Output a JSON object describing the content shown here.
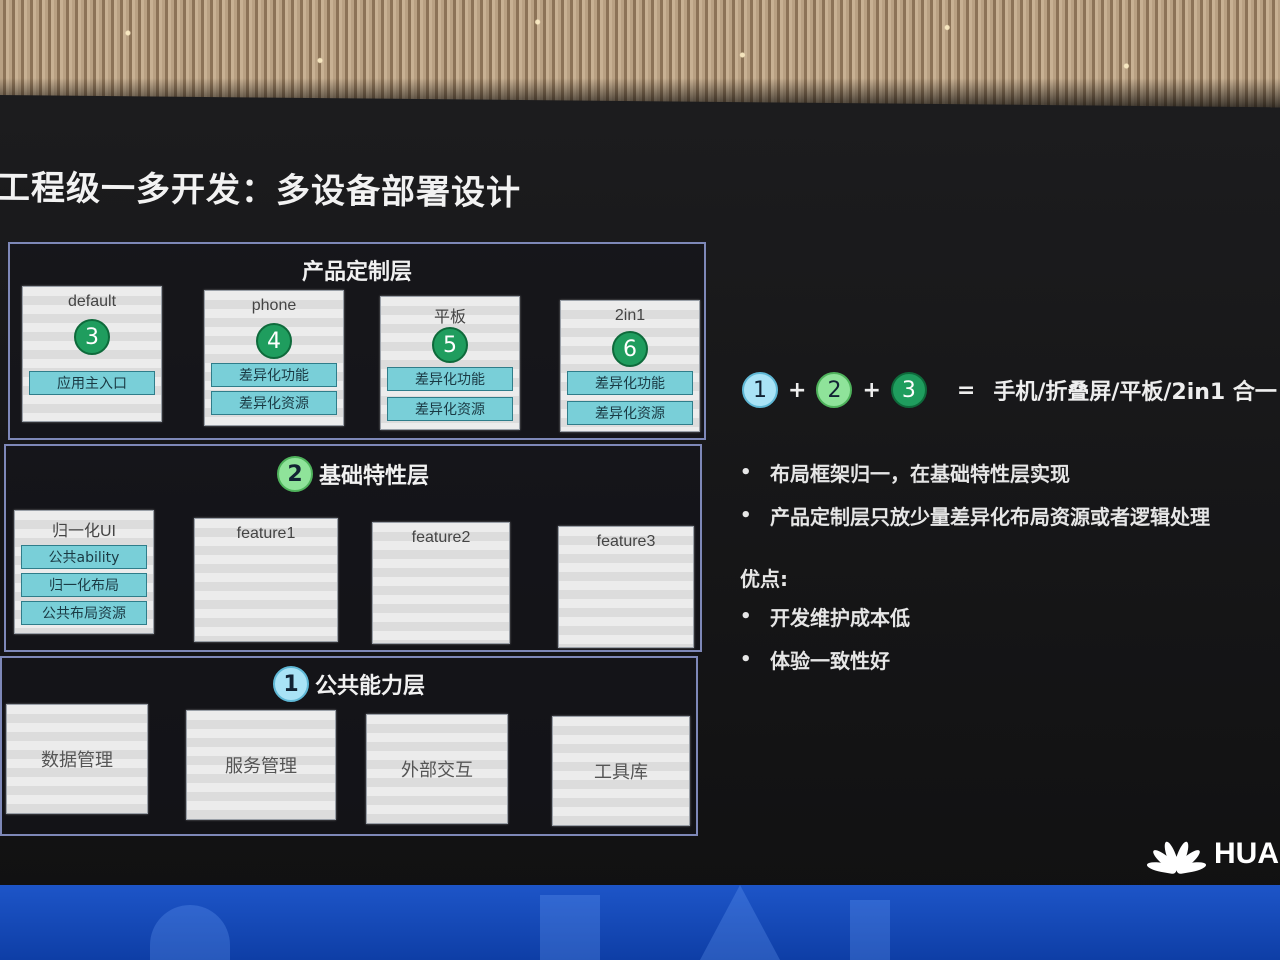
{
  "title": "工程级一多开发：多设备部署设计",
  "product_layer": {
    "title": "产品定制层",
    "cards": [
      {
        "label": "default",
        "number": "3",
        "items": [
          "应用主入口"
        ]
      },
      {
        "label": "phone",
        "number": "4",
        "items": [
          "差异化功能",
          "差异化资源"
        ]
      },
      {
        "label": "平板",
        "number": "5",
        "items": [
          "差异化功能",
          "差异化资源"
        ]
      },
      {
        "label": "2in1",
        "number": "6",
        "items": [
          "差异化功能",
          "差异化资源"
        ]
      }
    ]
  },
  "feature_layer": {
    "number": "2",
    "title": "基础特性层",
    "cards": [
      {
        "label": "归一化UI",
        "items": [
          "公共ability",
          "归一化布局",
          "公共布局资源"
        ]
      },
      {
        "label": "feature1",
        "items": []
      },
      {
        "label": "feature2",
        "items": []
      },
      {
        "label": "feature3",
        "items": []
      }
    ]
  },
  "common_layer": {
    "number": "1",
    "title": "公共能力层",
    "cards": [
      "数据管理",
      "服务管理",
      "外部交互",
      "工具库"
    ]
  },
  "formula": {
    "n1": "1",
    "plus1": "+",
    "n2": "2",
    "plus2": "+",
    "n3": "3",
    "equals": "=",
    "result": "手机/折叠屏/平板/2in1 合一"
  },
  "bullets": [
    "布局框架归一，在基础特性层实现",
    "产品定制层只放少量差异化布局资源或者逻辑处理"
  ],
  "advantages_heading": "优点:",
  "advantages": [
    "开发维护成本低",
    "体验一致性好"
  ],
  "logo_text": "HUA",
  "colors": {
    "green_dark": "#1f9d5e",
    "green_light": "#8fe39a",
    "sky": "#a9e3f6",
    "pill": "#79cfd8",
    "layer_border": "#7e88b8"
  }
}
